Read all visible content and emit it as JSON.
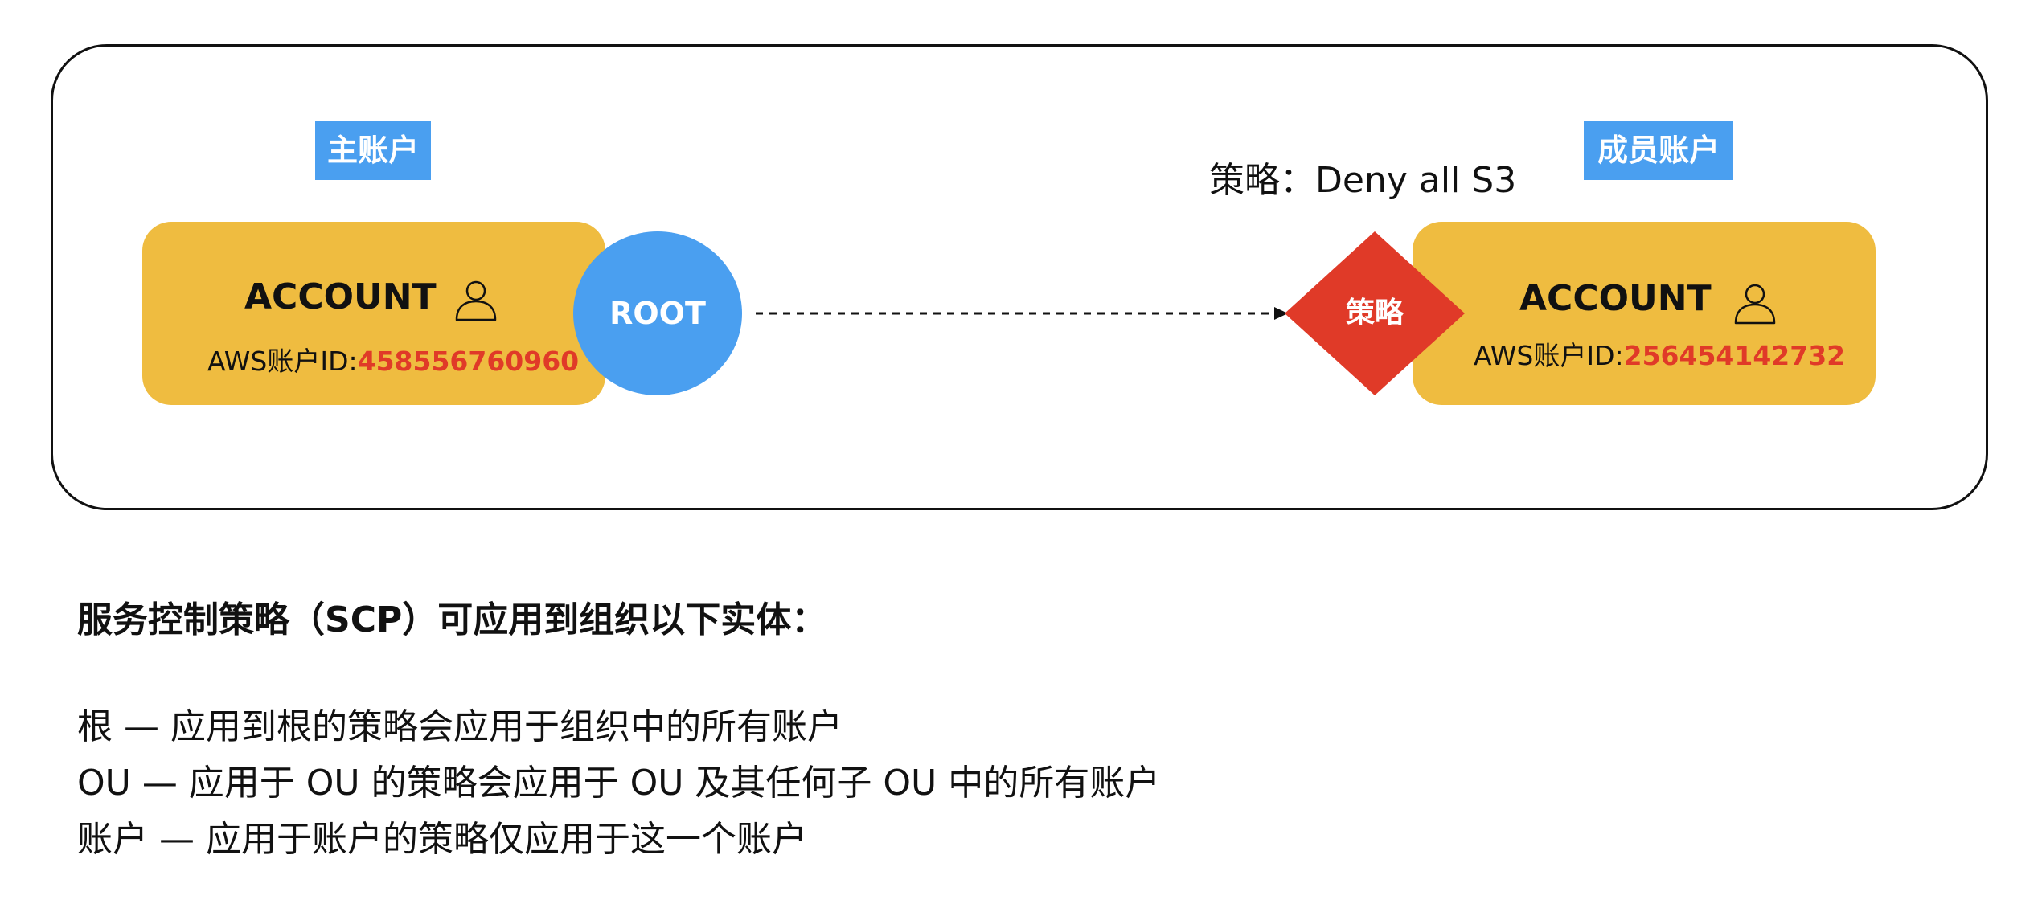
{
  "diagram": {
    "master_tag": "主账户",
    "member_tag": "成员账户",
    "policy_caption": "策略：Deny all S3",
    "root_label": "ROOT",
    "policy_label": "策略",
    "left_account": {
      "title": "ACCOUNT",
      "id_label": "AWS账户ID:",
      "id_value": "458556760960"
    },
    "right_account": {
      "title": "ACCOUNT",
      "id_label": "AWS账户ID:",
      "id_value": "256454142732"
    },
    "colors": {
      "account_fill": "#efbc40",
      "blue": "#4a9ff0",
      "policy_red": "#e03a28"
    },
    "icons": {
      "account_icon": "user-icon"
    }
  },
  "text": {
    "heading": "服务控制策略（SCP）可应用到组织以下实体：",
    "lines": [
      "根 — 应用到根的策略会应用于组织中的所有账户",
      "OU — 应用于 OU 的策略会应用于 OU 及其任何子 OU 中的所有账户",
      "账户 — 应用于账户的策略仅应用于这一个账户"
    ]
  }
}
